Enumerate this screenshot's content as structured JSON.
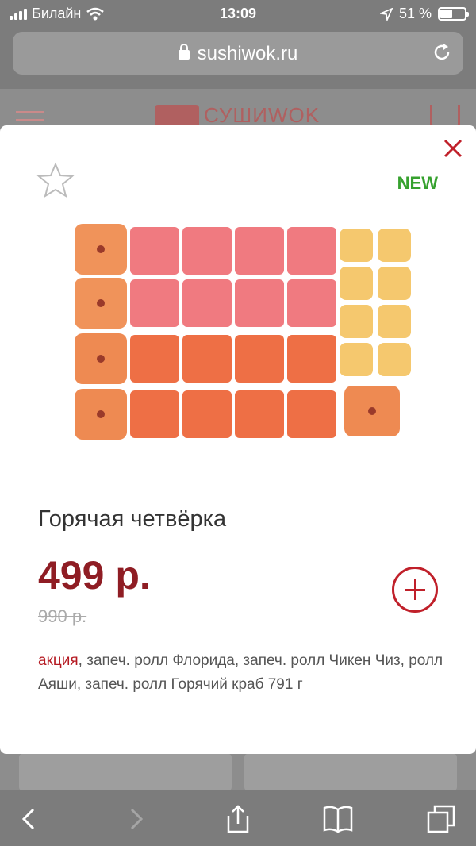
{
  "status": {
    "carrier": "Билайн",
    "time": "13:09",
    "battery": "51 %",
    "battery_level": 0.51
  },
  "browser": {
    "url": "sushiwok.ru"
  },
  "site": {
    "logo": "СУШИWOK"
  },
  "product": {
    "badge": "NEW",
    "title": "Горячая четвёрка",
    "price": "499 р.",
    "old_price": "990 р.",
    "promo_label": "акция",
    "description": ", запеч. ролл Флорида, запеч. ролл Чикен Чиз, ролл Аяши, запеч. ролл Горячий краб 791 г"
  }
}
